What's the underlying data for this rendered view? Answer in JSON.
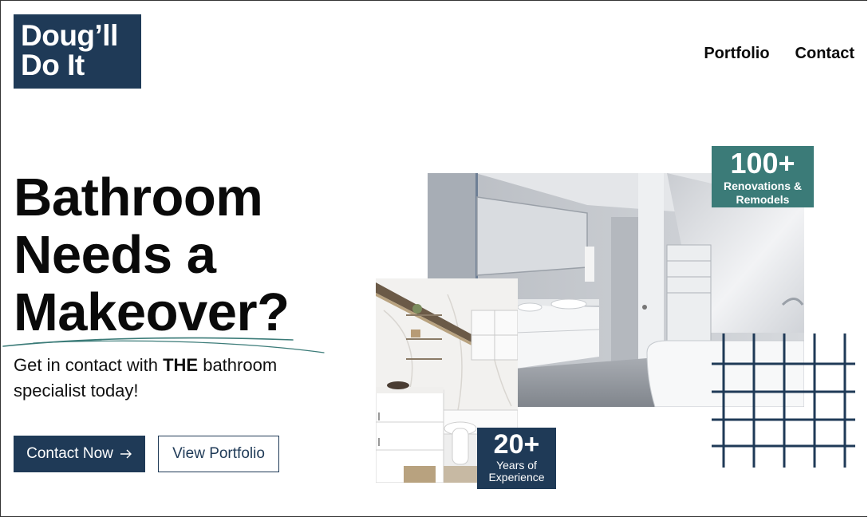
{
  "logo": {
    "line1": "Doug’ll",
    "line2": "Do It"
  },
  "nav": {
    "portfolio": "Portfolio",
    "contact": "Contact"
  },
  "hero": {
    "title_line1": "Bathroom",
    "title_line2": "Needs a",
    "title_line3": "Makeover?",
    "subtitle_before": "Get in contact with ",
    "subtitle_bold": "THE",
    "subtitle_after": " bathroom specialist today!"
  },
  "buttons": {
    "contact_now": "Contact Now",
    "contact_now_icon": "arrow-right-icon",
    "view_portfolio": "View Portfolio"
  },
  "stats": {
    "renovations_number": "100+",
    "renovations_label": "Renovations & Remodels",
    "experience_number": "20+",
    "experience_label": "Years of Experience"
  },
  "colors": {
    "navy": "#1f3a57",
    "teal": "#3b7b78"
  }
}
